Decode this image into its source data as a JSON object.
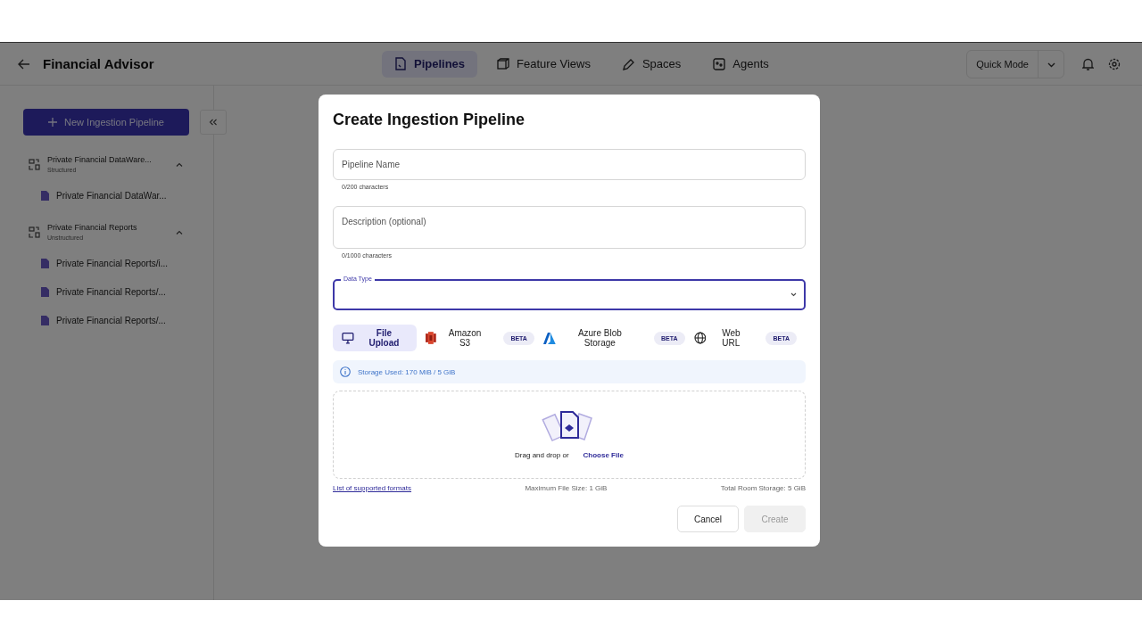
{
  "app": {
    "title": "Financial Advisor"
  },
  "nav_tabs": [
    {
      "label": "Pipelines",
      "kind": "pipelines",
      "selected": true
    },
    {
      "label": "Feature Views",
      "kind": "cube",
      "selected": false
    },
    {
      "label": "Spaces",
      "kind": "pen",
      "selected": false
    },
    {
      "label": "Agents",
      "kind": "agent",
      "selected": false
    }
  ],
  "mode_button": "Quick Mode",
  "sidebar": {
    "new_button": "New Ingestion Pipeline",
    "pipelines": [
      {
        "name": "Private Financial DataWare...",
        "type": "Structured",
        "expanded": true,
        "children": [
          {
            "name": "Private Financial DataWar..."
          }
        ]
      },
      {
        "name": "Private Financial Reports",
        "type": "Unstructured",
        "expanded": true,
        "children": [
          {
            "name": "Private Financial Reports/i..."
          },
          {
            "name": "Private Financial Reports/..."
          },
          {
            "name": "Private Financial Reports/..."
          }
        ]
      }
    ]
  },
  "dialog": {
    "title": "Create Ingestion Pipeline",
    "fields": [
      {
        "kind": "text",
        "placeholder": "Pipeline Name",
        "helper": "0/200 characters"
      },
      {
        "kind": "textarea",
        "placeholder": "Description (optional)",
        "helper": "0/1000 characters"
      },
      {
        "kind": "select",
        "label": "Data Type",
        "focused": true
      }
    ],
    "sources": [
      {
        "kind": "monitor",
        "label": "File Upload",
        "selected": true
      },
      {
        "kind": "s3",
        "label": "Amazon S3",
        "badge": "BETA",
        "selected": false
      },
      {
        "kind": "azure",
        "label": "Azure Blob Storage",
        "badge": "BETA",
        "selected": false
      },
      {
        "kind": "globe",
        "label": "Web URL",
        "badge": "BETA",
        "selected": false
      }
    ],
    "storage_notice": "Storage Used: 170 MiB / 5 GiB",
    "dropzone": {
      "text": "Drag and drop or",
      "link": "Choose File"
    },
    "formats_link": "List of supported formats",
    "max_size": "Maximum File Size: 1 GiB",
    "total_storage": "Total Room Storage: 5 GiB",
    "buttons": [
      {
        "label": "Cancel",
        "disabled": false
      },
      {
        "label": "Create",
        "disabled": true
      }
    ]
  }
}
